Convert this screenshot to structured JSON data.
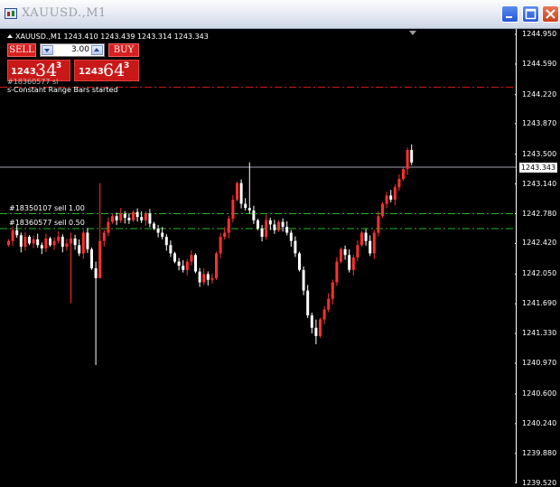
{
  "window": {
    "title": "XAUUSD.,M1"
  },
  "header": {
    "symbol": "XAUUSD.,M1",
    "ohlc": "1243.410 1243.439 1243.314 1243.343"
  },
  "trade_panel": {
    "sell_label": "SELL",
    "buy_label": "BUY",
    "lot": "3.00",
    "bid": {
      "small": "1243",
      "big": "34",
      "sup": "3"
    },
    "ask": {
      "small": "1243",
      "big": "64",
      "sup": "3"
    }
  },
  "messages": {
    "line1": "#18360577 sl",
    "line2": "s-Constant Range Bars started"
  },
  "colors": {
    "bull": "#ff3030",
    "bear": "#ffffff",
    "sl_line": "#d01818",
    "order_line": "#22bb22",
    "price_line": "#a0a4b4"
  },
  "chart_data": {
    "type": "candlestick",
    "ylim": [
      1239.55,
      1244.95
    ],
    "y_ticks": [
      "1244.950",
      "1244.590",
      "1244.220",
      "1243.870",
      "1243.500",
      "1243.140",
      "1242.780",
      "1242.420",
      "1242.050",
      "1241.690",
      "1241.330",
      "1240.970",
      "1240.600",
      "1240.240",
      "1239.880",
      "1239.520"
    ],
    "current_price": 1243.343,
    "current_price_label": "1243.343",
    "order_lines": [
      {
        "label": "#18350107 sell 1.00",
        "price": 1242.78
      },
      {
        "label": "#18360577 sell 0.50",
        "price": 1242.6
      }
    ],
    "stop_loss_price": 1244.31,
    "closes": [
      1242.45,
      1242.58,
      1242.52,
      1242.38,
      1242.5,
      1242.42,
      1242.47,
      1242.4,
      1242.36,
      1242.48,
      1242.4,
      1242.45,
      1242.5,
      1242.38,
      1242.42,
      1242.48,
      1242.4,
      1242.3,
      1242.55,
      1242.35,
      1242.12,
      1242.0,
      1242.45,
      1242.55,
      1242.68,
      1242.75,
      1242.7,
      1242.78,
      1242.73,
      1242.7,
      1242.8,
      1242.74,
      1242.7,
      1242.78,
      1242.66,
      1242.6,
      1242.55,
      1242.5,
      1242.4,
      1242.3,
      1242.2,
      1242.15,
      1242.1,
      1242.2,
      1242.28,
      1242.08,
      1241.95,
      1242.05,
      1241.98,
      1242.0,
      1242.3,
      1242.5,
      1242.55,
      1242.72,
      1242.95,
      1243.15,
      1242.9,
      1242.85,
      1242.82,
      1242.7,
      1242.6,
      1242.5,
      1242.7,
      1242.65,
      1242.58,
      1242.68,
      1242.62,
      1242.55,
      1242.45,
      1242.3,
      1242.1,
      1241.85,
      1241.55,
      1241.4,
      1241.3,
      1241.5,
      1241.62,
      1241.75,
      1241.95,
      1242.2,
      1242.35,
      1242.28,
      1242.1,
      1242.25,
      1242.4,
      1242.55,
      1242.45,
      1242.3,
      1242.55,
      1242.75,
      1242.9,
      1243.0,
      1242.95,
      1243.1,
      1243.2,
      1243.32,
      1243.55,
      1243.4
    ],
    "shadow_extremes": [
      {
        "index": 22,
        "high": 1243.15,
        "low": 1242.38
      },
      {
        "index": 15,
        "high": 1242.55,
        "low": 1241.7
      },
      {
        "index": 21,
        "high": 1242.2,
        "low": 1240.95
      },
      {
        "index": 58,
        "high": 1243.4,
        "low": 1242.78
      },
      {
        "index": 74,
        "high": 1241.5,
        "low": 1241.2
      },
      {
        "index": 96,
        "high": 1243.58,
        "low": 1243.25
      }
    ]
  }
}
